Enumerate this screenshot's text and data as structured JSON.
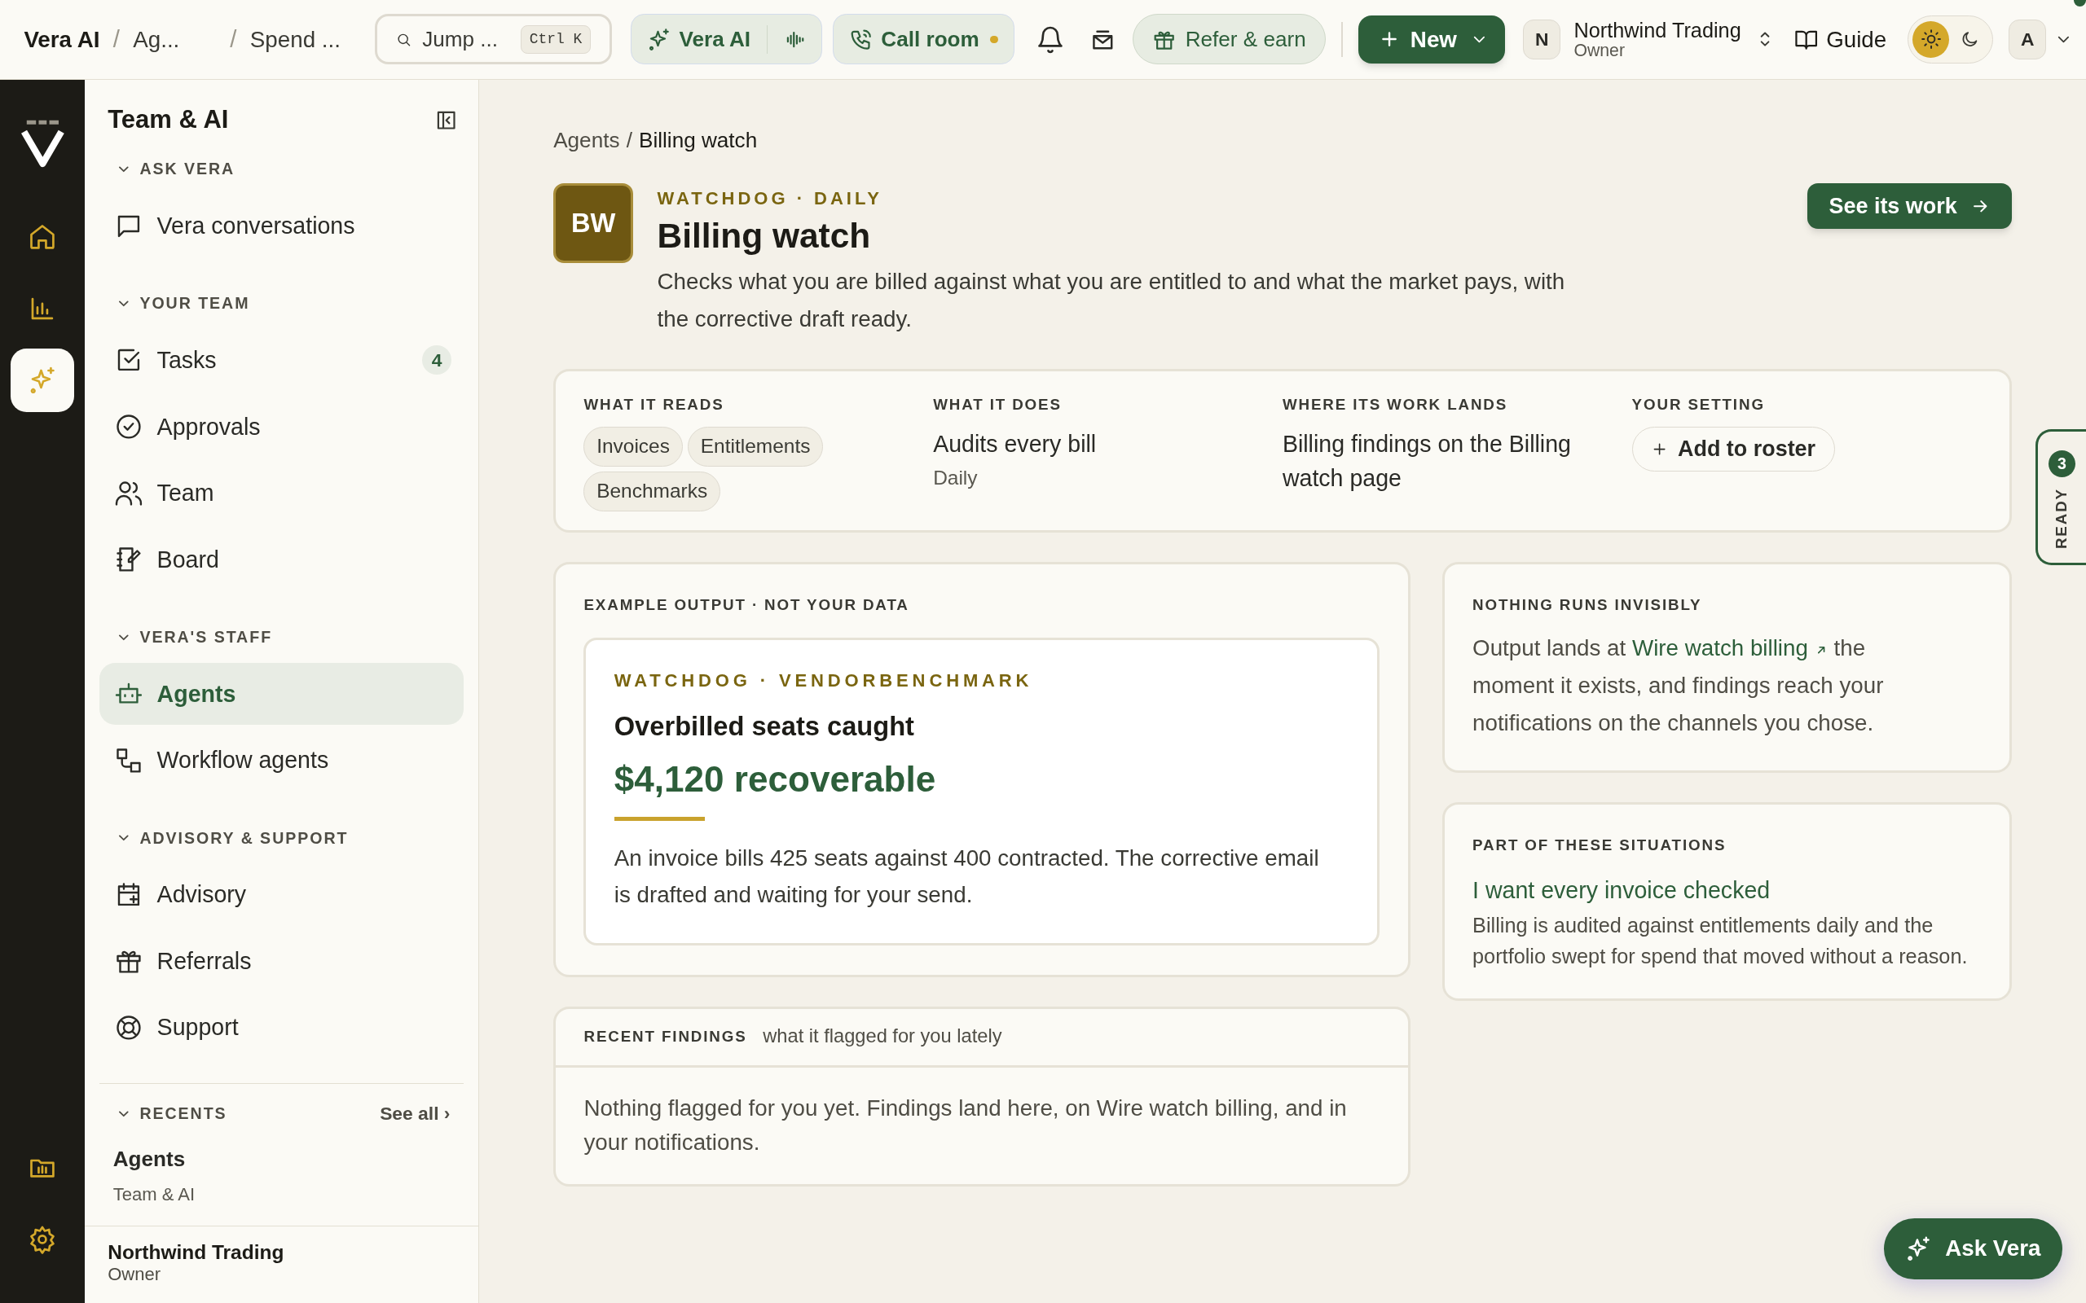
{
  "topbar": {
    "breadcrumbs": [
      "Vera AI",
      "Ag...",
      "Spend ..."
    ],
    "separators": [
      "/",
      "/"
    ],
    "search": {
      "placeholder": "Jump ...",
      "shortcut": "Ctrl K"
    },
    "vera_button": "Vera AI",
    "call_button": "Call room",
    "refer_button": "Refer & earn",
    "new_button": "New",
    "org": {
      "initial": "N",
      "name": "Northwind Trading",
      "role": "Owner"
    },
    "guide": "Guide",
    "theme": {
      "light_selected": true
    },
    "user_initial": "A"
  },
  "rail": [
    {
      "selected": false
    },
    {
      "selected": false
    },
    {
      "selected": true
    },
    {
      "selected": false
    },
    {
      "selected": false
    }
  ],
  "sidebar": {
    "title": "Team & AI",
    "sections": [
      {
        "label": "ASK VERA",
        "expanded": true,
        "items": [
          {
            "label": "Vera conversations",
            "selected": false
          }
        ]
      },
      {
        "label": "YOUR TEAM",
        "expanded": true,
        "items": [
          {
            "label": "Tasks",
            "selected": false,
            "badge": "4"
          },
          {
            "label": "Approvals",
            "selected": false
          },
          {
            "label": "Team",
            "selected": false
          },
          {
            "label": "Board",
            "selected": false
          }
        ]
      },
      {
        "label": "VERA'S STAFF",
        "expanded": true,
        "items": [
          {
            "label": "Agents",
            "selected": true
          },
          {
            "label": "Workflow agents",
            "selected": false
          }
        ]
      },
      {
        "label": "ADVISORY & SUPPORT",
        "expanded": true,
        "items": [
          {
            "label": "Advisory",
            "selected": false
          },
          {
            "label": "Referrals",
            "selected": false
          },
          {
            "label": "Support",
            "selected": false
          }
        ]
      }
    ],
    "recents": {
      "label": "RECENTS",
      "see_all": "See all ›",
      "items": [
        {
          "title": "Agents",
          "subtitle": "Team & AI"
        }
      ]
    },
    "footer": {
      "name": "Northwind Trading",
      "role": "Owner"
    }
  },
  "main": {
    "breadcrumb": [
      "Agents",
      "Billing watch"
    ],
    "breadcrumb_separator": "/",
    "avatar": "BW",
    "eyebrow": "WATCHDOG · DAILY",
    "title": "Billing watch",
    "description": "Checks what you are billed against what you are entitled to and what the market pays, with the corrective draft ready.",
    "action": "See its work",
    "facts": [
      {
        "heading": "WHAT IT READS",
        "kind": "tags",
        "tags": [
          "Invoices",
          "Entitlements",
          "Benchmarks"
        ]
      },
      {
        "heading": "WHAT IT DOES",
        "kind": "text",
        "text": "Audits every bill",
        "sub": "Daily"
      },
      {
        "heading": "WHERE ITS WORK LANDS",
        "kind": "text",
        "text": "Billing findings on the Billing watch page"
      },
      {
        "heading": "YOUR SETTING",
        "kind": "button",
        "button": "Add to roster"
      }
    ],
    "example": {
      "label": "EXAMPLE OUTPUT · NOT YOUR DATA",
      "eyebrow": "WATCHDOG · VENDORBENCHMARK",
      "title": "Overbilled seats caught",
      "amount": "$4,120 recoverable",
      "body": "An invoice bills 425 seats against 400 contracted. The corrective email is drafted and waiting for your send."
    },
    "findings": {
      "label": "RECENT FINDINGS",
      "hint": "what it flagged for you lately",
      "empty": "Nothing flagged for you yet. Findings land here, on Wire watch billing, and in your notifications."
    },
    "invisible": {
      "label": "NOTHING RUNS INVISIBLY",
      "before": "Output lands at",
      "link": "Wire watch billing",
      "after": "the moment it exists, and findings reach your notifications on the channels you chose."
    },
    "situations": {
      "label": "PART OF THESE SITUATIONS",
      "link": "I want every invoice checked",
      "text": "Billing is audited against entitlements daily and the portfolio swept for spend that moved without a reason."
    }
  },
  "ready_tab": {
    "label": "READY",
    "count": "3"
  },
  "ask_button": "Ask Vera"
}
